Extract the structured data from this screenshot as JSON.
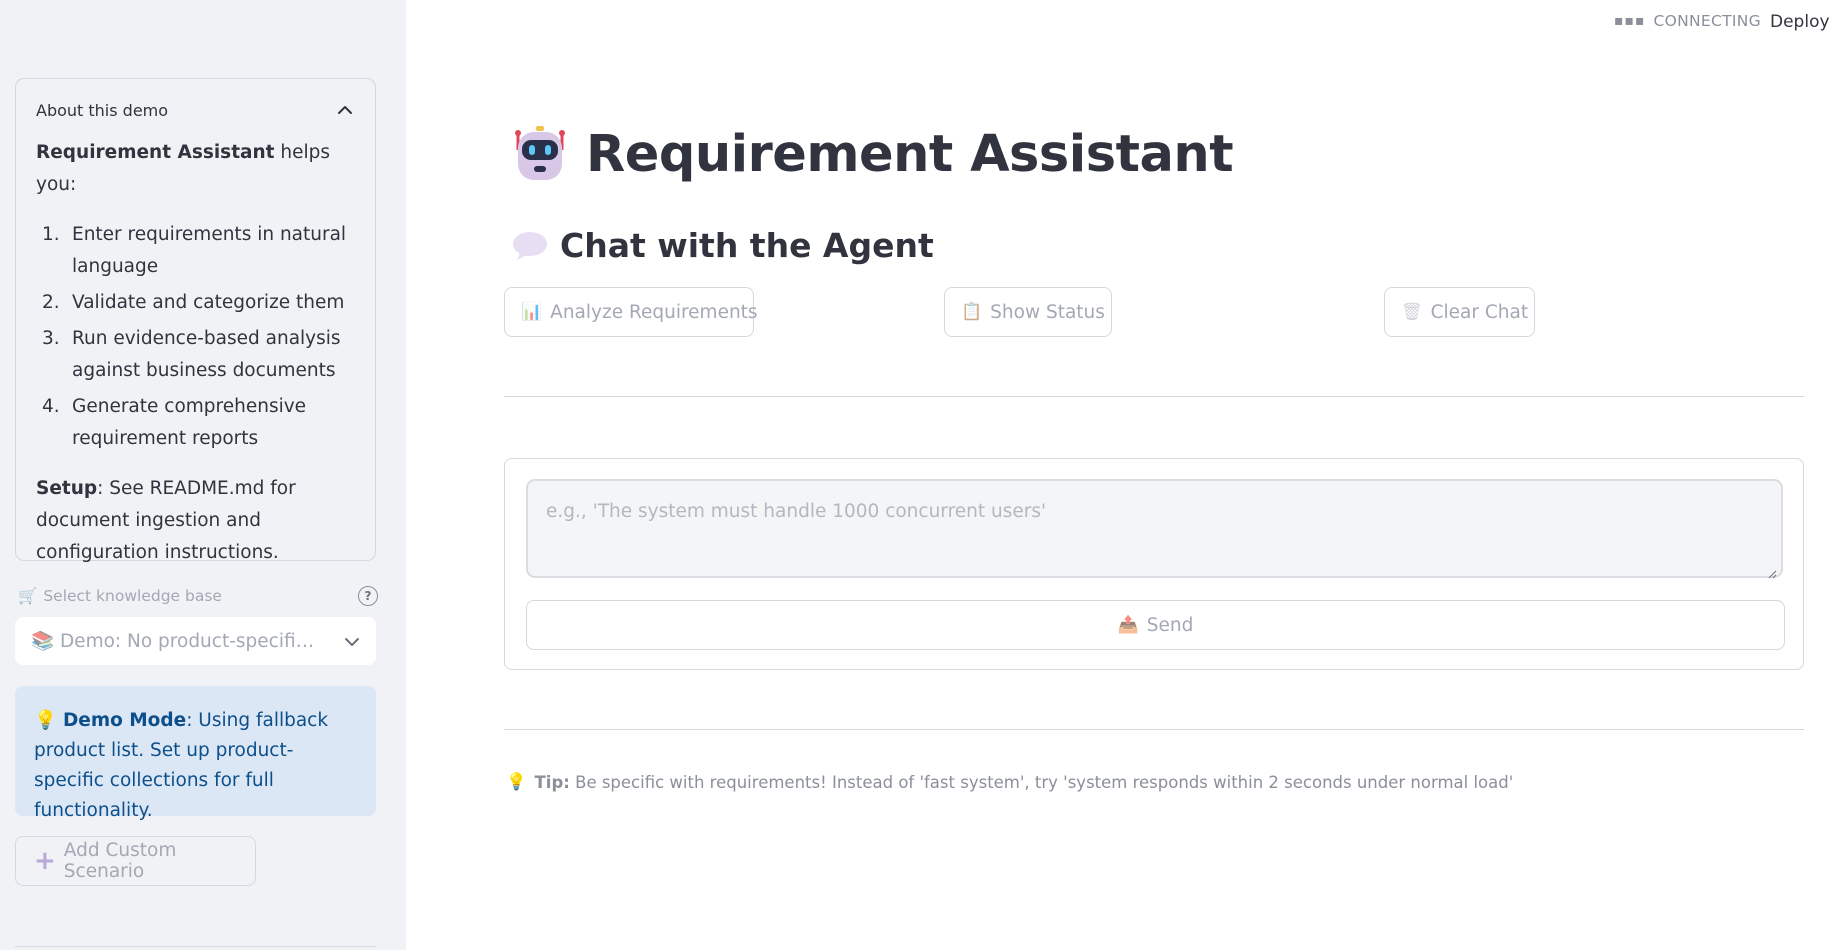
{
  "header": {
    "status_text": "CONNECTING",
    "deploy_label": "Deploy"
  },
  "sidebar": {
    "about": {
      "title": "About this demo",
      "intro_bold": "Requirement Assistant",
      "intro_rest": " helps you:",
      "items": [
        {
          "num": "1.",
          "text": "Enter requirements in natural language"
        },
        {
          "num": "2.",
          "text": "Validate and categorize them"
        },
        {
          "num": "3.",
          "text": "Run evidence-based analysis against business documents"
        },
        {
          "num": "4.",
          "text": "Generate comprehensive requirement reports"
        }
      ],
      "setup_bold": "Setup",
      "setup_rest": ": See README.md for document ingestion and configuration instructions."
    },
    "knowledge_base": {
      "label": "Select knowledge base",
      "label_icon": "🛒",
      "selected_icon": "📚",
      "selected": "Demo: No product-specific collections"
    },
    "info": {
      "icon": "💡",
      "bold": "Demo Mode",
      "text": ": Using fallback product list. Set up product-specific collections for full functionality."
    },
    "add_button_label": "Add Custom Scenario"
  },
  "main": {
    "title": "Requirement Assistant",
    "subtitle": "Chat with the Agent",
    "buttons": {
      "analyze": {
        "icon": "📊",
        "label": "Analyze Requirements"
      },
      "status": {
        "icon": "📋",
        "label": "Show Status"
      },
      "clear": {
        "icon": "🗑",
        "label": "Clear Chat"
      }
    },
    "input": {
      "placeholder": "e.g., 'The system must handle 1000 concurrent users'",
      "value": ""
    },
    "send": {
      "icon": "📤",
      "label": "Send"
    },
    "tip": {
      "icon": "💡",
      "bold": "Tip:",
      "text": "Be specific with requirements! Instead of 'fast system', try 'system responds within 2 seconds under normal load'"
    }
  },
  "colors": {
    "sidebar_bg": "#f0f2f6",
    "info_bg": "#dce7f5",
    "info_text": "#0d4f8b",
    "disabled_text": "#a3a8b4"
  }
}
